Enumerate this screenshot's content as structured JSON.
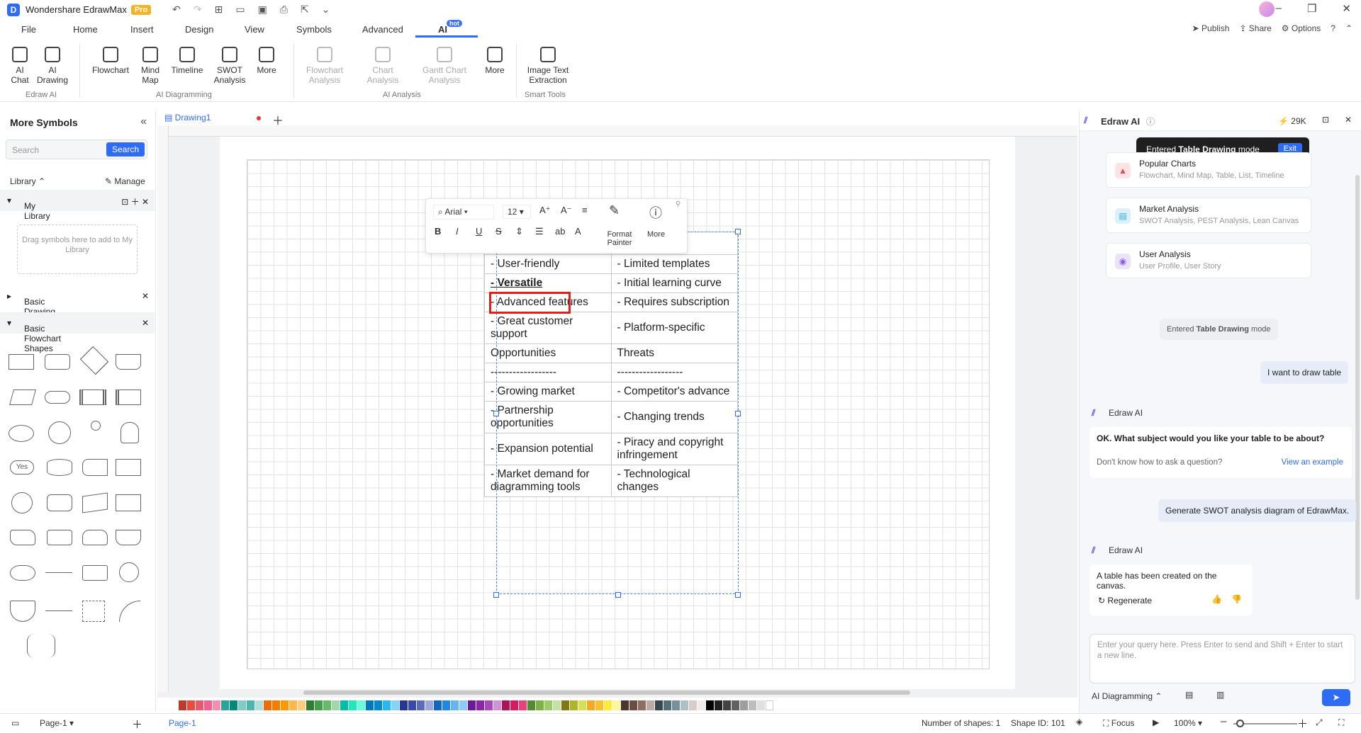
{
  "app": {
    "name": "Wondershare EdrawMax",
    "badge": "Pro"
  },
  "menu": [
    "File",
    "Home",
    "Insert",
    "Design",
    "View",
    "Symbols",
    "Advanced",
    "AI"
  ],
  "menu_hot": "hot",
  "menu_right": {
    "publish": "Publish",
    "share": "Share",
    "options": "Options"
  },
  "ribbon": {
    "buttons": [
      "AI Chat",
      "AI Drawing",
      "Flowchart",
      "Mind Map",
      "Timeline",
      "SWOT Analysis",
      "More",
      "Flowchart Analysis",
      "Chart Analysis",
      "Gantt Chart Analysis",
      "More",
      "Image Text Extraction"
    ],
    "groups": [
      "Edraw AI",
      "AI Diagramming",
      "AI Analysis",
      "Smart Tools"
    ]
  },
  "left": {
    "title": "More Symbols",
    "search_placeholder": "Search",
    "search_btn": "Search",
    "library": "Library",
    "manage": "Manage",
    "my_library": "My Library",
    "drag_hint": "Drag symbols here to add to My Library",
    "basic_drawing": "Basic Drawing Shapes",
    "basic_flowchart": "Basic Flowchart Shapes",
    "yes_shape": "Yes"
  },
  "canvas": {
    "tab": "Drawing1"
  },
  "toolbar": {
    "font": "Arial",
    "size": "12",
    "format_painter": "Format Painter",
    "more": "More"
  },
  "table": {
    "rows": [
      [
        "- User-friendly",
        "- Limited templates"
      ],
      [
        "- Versatile",
        "- Initial learning curve"
      ],
      [
        "- Advanced features",
        "- Requires subscription"
      ],
      [
        "- Great customer support",
        "- Platform-specific"
      ],
      [
        "Opportunities",
        "Threats"
      ],
      [
        "------------------",
        "------------------"
      ],
      [
        "- Growing market",
        "- Competitor's advance"
      ],
      [
        "- Partnership opportunities",
        "- Changing trends"
      ],
      [
        "- Expansion potential",
        "- Piracy and copyright infringement"
      ],
      [
        "- Market demand for diagramming tools",
        "- Technological changes"
      ]
    ]
  },
  "right": {
    "title": "Edraw AI",
    "credits": "29K",
    "tooltip_pre": "Entered ",
    "tooltip_bold": "Table Drawing",
    "tooltip_post": " mode",
    "exit": "Exit",
    "cards": [
      {
        "t": "Popular Charts",
        "s": "Flowchart, Mind Map, Table, List, Timeline"
      },
      {
        "t": "Market Analysis",
        "s": "SWOT Analysis, PEST Analysis, Lean Canvas"
      },
      {
        "t": "User Analysis",
        "s": "User Profile, User Story"
      }
    ],
    "entered_pre": "Entered ",
    "entered_bold": "Table Drawing",
    "entered_post": " mode",
    "msg_user1": "I want to draw table",
    "ai_name": "Edraw AI",
    "msg_ai1": "OK. What subject would you like your table to be about?",
    "dont_know": "Don't know how to ask a question?",
    "view_example": "View an example",
    "msg_user2": "Generate SWOT analysis diagram of EdrawMax.",
    "msg_ai2": "A table has been created on the canvas.",
    "regenerate": "Regenerate",
    "input_placeholder": "Enter your query here. Press Enter to send and Shift + Enter to start a new line.",
    "mode": "AI Diagramming"
  },
  "status": {
    "page": "Page-1",
    "page_tab": "Page-1",
    "shapes": "Number of shapes: 1",
    "shape_id": "Shape ID: 101",
    "focus": "Focus",
    "zoom": "100%"
  },
  "palette": [
    "#c0392b",
    "#e74c3c",
    "#e8596d",
    "#f06292",
    "#f48fb1",
    "#26a69a",
    "#00897b",
    "#80cbc4",
    "#4db6ac",
    "#b2dfdb",
    "#ef6c00",
    "#f57c00",
    "#ff9800",
    "#ffb74d",
    "#ffcc80",
    "#2e7d32",
    "#43a047",
    "#66bb6a",
    "#a5d6a7",
    "#00bfa5",
    "#1de9b6",
    "#64ffda",
    "#0277bd",
    "#0288d1",
    "#29b6f6",
    "#81d4fa",
    "#283593",
    "#3949ab",
    "#5c6bc0",
    "#9fa8da",
    "#1565c0",
    "#1e88e5",
    "#64b5f6",
    "#90caf9",
    "#6a1b9a",
    "#8e24aa",
    "#ab47bc",
    "#ce93d8",
    "#ad1457",
    "#d81b60",
    "#ec407a",
    "#558b2f",
    "#7cb342",
    "#9ccc65",
    "#c5e1a5",
    "#827717",
    "#afb42b",
    "#d4e157",
    "#f9a825",
    "#fbc02d",
    "#ffeb3b",
    "#fff59d",
    "#4e342e",
    "#6d4c41",
    "#8d6e63",
    "#bcaaa4",
    "#37474f",
    "#546e7a",
    "#78909c",
    "#b0bec5",
    "#d7ccc8",
    "#efebe9",
    "#000000",
    "#212121",
    "#424242",
    "#616161",
    "#9e9e9e",
    "#bdbdbd",
    "#e0e0e0",
    "#ffffff"
  ]
}
